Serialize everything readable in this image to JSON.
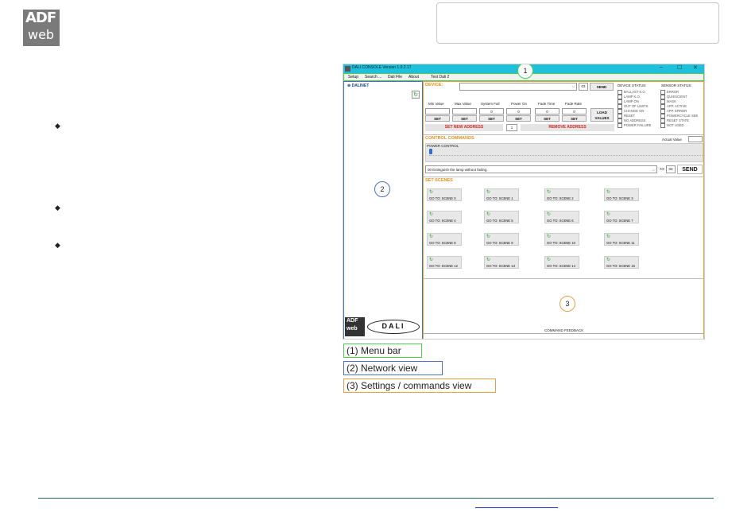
{
  "header": {
    "logo_line1": "ADF",
    "logo_line2": "web"
  },
  "app": {
    "title": "DALI CONSOLE Version 1.0.2.17",
    "window_controls": [
      "–",
      "☐",
      "✕"
    ],
    "menu": [
      "Setup",
      "Search ...",
      "Dali File",
      "About",
      "Test Dali 2"
    ],
    "network_root": "DALINET",
    "device": {
      "title": "DEVICE:",
      "address_value": "03",
      "send_label": "SEND",
      "fields": [
        {
          "label": "Min Value",
          "value": "",
          "set": "SET"
        },
        {
          "label": "Max Value",
          "value": "",
          "set": "SET"
        },
        {
          "label": "System Fail",
          "value": "0",
          "set": "SET"
        },
        {
          "label": "Power On",
          "value": "0",
          "set": "SET"
        },
        {
          "label": "Fade Time",
          "value": "0",
          "set": "SET"
        },
        {
          "label": "Fade Rate",
          "value": "0",
          "set": "SET"
        }
      ],
      "load_values": "LOAD VALUES",
      "set_new_address": "SET NEW ADDRESS",
      "new_address_value": "1",
      "remove_address": "REMOVE ADDRESS"
    },
    "device_status": {
      "title": "DEVICE STATUS:",
      "items": [
        "BALLAST K.O.",
        "LAMP K.O.",
        "LAMP ON",
        "OUT OF LIMITS",
        "CHANGE ON",
        "RESET",
        "NO ADDRESS",
        "POWER FAILURE"
      ]
    },
    "sensor_status": {
      "title": "SENSOR STATUS:",
      "items": [
        "ERROR",
        "QUIESCIENT",
        "MASK",
        "APP. ACTIVE",
        "APP. ERROR",
        "POWERCYCLE SEE",
        "RESET STATE",
        "NOT USED"
      ]
    },
    "control": {
      "title": "CONTROL COMMANDS",
      "actual_value_label": "Actual Value",
      "power_control_label": "POWER CONTROL",
      "command_selected": "00 Extinguish the lamp without fading",
      "xx_label": "XX",
      "address_value": "03",
      "send_label": "SEND"
    },
    "scenes": {
      "title": "SET SCENES",
      "items": [
        "GO TO: SCENE 0",
        "GO TO: SCENE 1",
        "GO TO: SCENE 2",
        "GO TO: SCENE 3",
        "GO TO: SCENE 4",
        "GO TO: SCENE 5",
        "GO TO: SCENE 6",
        "GO TO: SCENE 7",
        "GO TO: SCENE 8",
        "GO TO: SCENE 9",
        "GO TO: SCENE 10",
        "GO TO: SCENE 11",
        "GO TO: SCENE 12",
        "GO TO: SCENE 13",
        "GO TO: SCENE 14",
        "GO TO: SCENE 15"
      ]
    },
    "command_feedback": "COMMAND FEEDBACK",
    "dali_logo": "DALI",
    "adf_small_1": "ADF",
    "adf_small_2": "web"
  },
  "markers": [
    "1",
    "2",
    "3"
  ],
  "captions": [
    "(1) Menu bar",
    "(2) Network view",
    "(3) Settings / commands view"
  ],
  "colors": {
    "menu_bar": "#4ccf4c",
    "network_view": "#4a6fd0",
    "settings_view": "#e8a040",
    "titlebar": "#1ec1d9"
  }
}
